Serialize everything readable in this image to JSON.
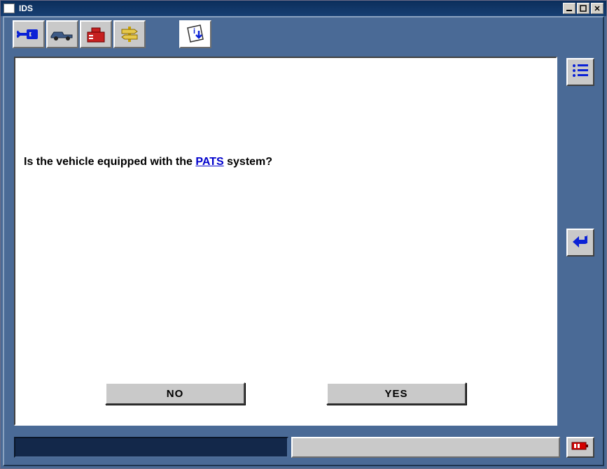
{
  "window": {
    "title": "IDS"
  },
  "toolbar": {
    "items": [
      {
        "name": "connection-icon"
      },
      {
        "name": "vehicle-icon"
      },
      {
        "name": "toolbox-icon"
      },
      {
        "name": "signpost-icon"
      },
      {
        "name": "info-download-icon"
      }
    ]
  },
  "question": {
    "prefix": "Is the vehicle equipped with the ",
    "link_text": "PATS",
    "suffix": " system?"
  },
  "answers": {
    "no_label": "NO",
    "yes_label": "YES"
  },
  "side": {
    "list_name": "list-view-icon",
    "back_name": "back-arrow-icon"
  },
  "status": {
    "battery_name": "battery-icon"
  },
  "colors": {
    "frame": "#4a6a96",
    "accent": "#0b22d6",
    "button_face": "#c9c9c9"
  }
}
